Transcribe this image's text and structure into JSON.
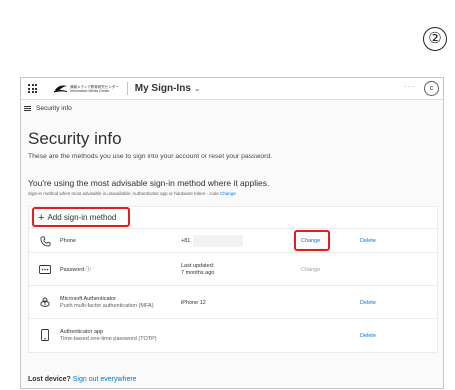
{
  "step_marker": "②",
  "topbar": {
    "org_name_jp": "情報メディア教育研究センター",
    "org_name_en": "Information Media Center",
    "app_title": "My Sign-Ins",
    "more_label": "···",
    "avatar_initial": "c"
  },
  "breadcrumb": {
    "label": "Security info"
  },
  "page": {
    "title": "Security info",
    "description": "These are the methods you use to sign into your account or reset your password.",
    "advice": "You're using the most advisable sign-in method where it applies.",
    "advice_sub": "Sign-in method when most advisable is unavailable: Authenticator app or hardware token - code",
    "advice_change": "Change"
  },
  "add_method": {
    "plus": "+",
    "label": "Add sign-in method"
  },
  "methods": [
    {
      "name": "Phone",
      "sub": "",
      "detail_line1": "+81",
      "detail_line2": "",
      "change": "Change",
      "delete": "Delete",
      "icon": "phone-icon"
    },
    {
      "name": "Password ⓘ",
      "sub": "",
      "detail_line1": "Last updated:",
      "detail_line2": "7 months ago",
      "change": "Change",
      "delete": "",
      "icon": "password-icon"
    },
    {
      "name": "Microsoft Authenticator",
      "sub": "Push multi-factor authentication (MFA)",
      "detail_line1": "iPhone 12",
      "detail_line2": "",
      "change": "",
      "delete": "Delete",
      "icon": "authenticator-icon"
    },
    {
      "name": "Authenticator app",
      "sub": "Time-based one-time password (TOTP)",
      "detail_line1": "",
      "detail_line2": "",
      "change": "",
      "delete": "Delete",
      "icon": "mobile-device-icon"
    }
  ],
  "footer": {
    "lost_label": "Lost device?",
    "sign_out_link": "Sign out everywhere"
  },
  "colors": {
    "accent": "#0078d4",
    "highlight": "#e02020",
    "text": "#323130"
  }
}
